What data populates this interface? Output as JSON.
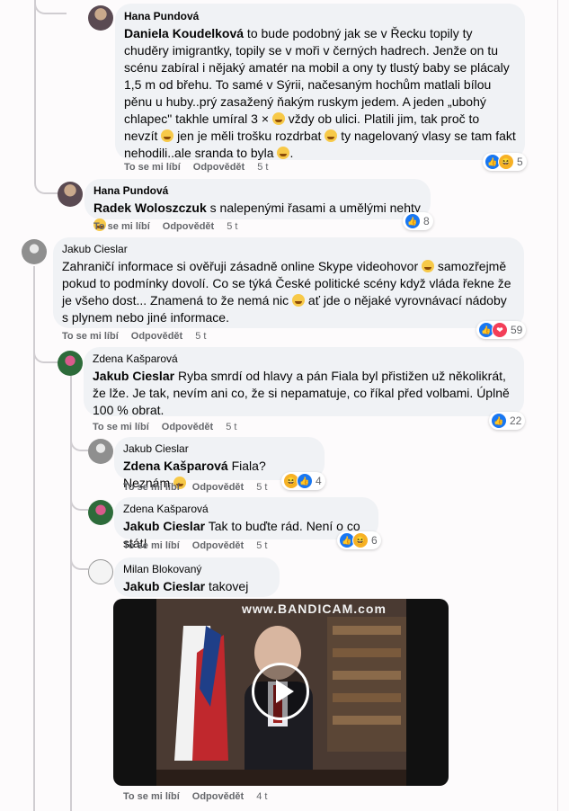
{
  "comments": [
    {
      "author": "Hana Pundová",
      "mention": "Daniela Koudelková",
      "text": " to bude podobný jak se v Řecku topily ty chuděry imigrantky, topily se v moři v černých hadrech. Jenže on tu scénu zabíral i nějaký amatér na mobil a ony ty tlustý baby se plácaly 1,5 m od břehu. To samé v Sýrii, načesaným hochům matlali bílou pěnu u huby..prý zasažený ňakým ruskym jedem. A jeden „ubohý chlapec\" takhle umíral 3 × ",
      "text2": " vždy ob ulici. Platili jim, tak proč to nevzít ",
      "text3": " jen je měli trošku rozdrbat ",
      "text4": " ty nagelovaný vlasy se tam fakt nehodili..ale sranda to byla ",
      "text5": ".",
      "like": "To se mi líbí",
      "reply": "Odpovědět",
      "time": "5 t",
      "reactions": "5"
    },
    {
      "author": "Hana Pundová",
      "mention": "Radek Woloszczuk",
      "text": " s nalepenými řasami a umělými nehty ",
      "like": "To se mi líbí",
      "reply": "Odpovědět",
      "time": "5 t",
      "reactions": "8"
    },
    {
      "author": "Jakub Cieslar",
      "text": "Zahraničí informace si ověřuji zásadně online Skype videohovor ",
      "text2": " samozřejmě pokud to podmínky dovolí. Co se týká České politické scény když vláda řekne že je všeho dost... Znamená to že nemá nic ",
      "text3": " ať jde o nějaké vyrovnávací nádoby s plynem nebo jiné informace.",
      "like": "To se mi líbí",
      "reply": "Odpovědět",
      "time": "5 t",
      "reactions": "59"
    },
    {
      "author": "Zdena Kašparová",
      "mention": "Jakub Cieslar",
      "text": " Ryba smrdí od hlavy a pán Fiala byl přistižen už několikrát, že lže. Je tak, nevím ani co, že si nepamatuje, co říkal před volbami. Úplně 100 % obrat.",
      "like": "To se mi líbí",
      "reply": "Odpovědět",
      "time": "5 t",
      "reactions": "22"
    },
    {
      "author": "Jakub Cieslar",
      "mention": "Zdena Kašparová",
      "text": " Fiala? Neznám ",
      "like": "To se mi líbí",
      "reply": "Odpovědět",
      "time": "5 t",
      "reactions": "4"
    },
    {
      "author": "Zdena Kašparová",
      "mention": "Jakub Cieslar",
      "text": " Tak to buďte rád. Není o co stát!",
      "like": "To se mi líbí",
      "reply": "Odpovědět",
      "time": "5 t",
      "reactions": "6"
    },
    {
      "author": "Milan Blokovaný",
      "mention": "Jakub Cieslar",
      "text": " takovej žvanil",
      "like": "To se mi líbí",
      "reply": "Odpovědět",
      "time": "4 t"
    }
  ],
  "video": {
    "watermark": "www.BANDICAM.com"
  },
  "colors": {
    "bubble": "#f0f2f5",
    "like": "#1877f2",
    "love": "#f33e58",
    "haha": "#f7b125"
  }
}
